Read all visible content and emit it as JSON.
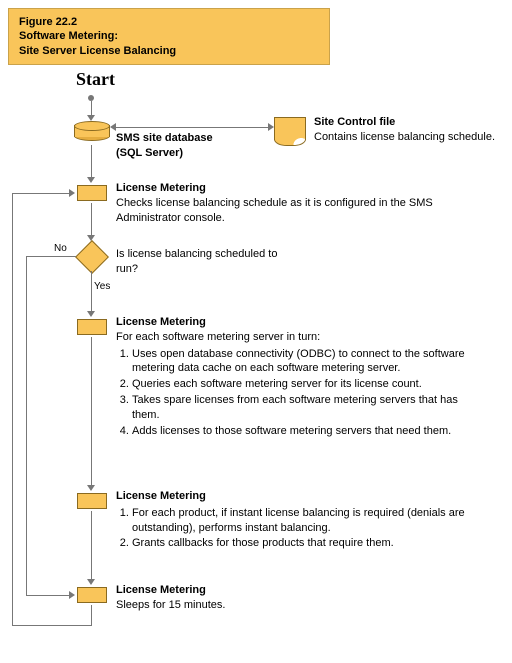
{
  "figure": {
    "number": "Figure 22.2",
    "title1": "Software Metering:",
    "title2": "Site Server License Balancing"
  },
  "start": "Start",
  "db": {
    "label1": "SMS site database",
    "label2": "(SQL Server)"
  },
  "sitectrl": {
    "heading": "Site Control file",
    "text": "Contains license balancing schedule."
  },
  "step1": {
    "heading": "License Metering",
    "text": "Checks license balancing schedule as it is configured in the SMS Administrator console."
  },
  "decision": {
    "question": "Is license balancing scheduled to run?",
    "yes": "Yes",
    "no": "No"
  },
  "step2": {
    "heading": "License Metering",
    "intro": "For each software metering server in turn:",
    "items": [
      "Uses open database connectivity (ODBC) to connect to the software metering data cache on each software metering server.",
      "Queries each software metering server for its license count.",
      "Takes spare licenses from each software metering servers that has them.",
      "Adds licenses to those software metering servers that need them."
    ]
  },
  "step3": {
    "heading": "License Metering",
    "items": [
      "For each product, if instant license balancing is required (denials are outstanding), performs instant balancing.",
      "Grants callbacks for those products that require them."
    ]
  },
  "step4": {
    "heading": "License Metering",
    "text": "Sleeps for 15 minutes."
  },
  "chart_data": {
    "type": "flowchart",
    "title": "Figure 22.2 — Software Metering: Site Server License Balancing",
    "nodes": [
      {
        "id": "start",
        "kind": "start",
        "label": "Start"
      },
      {
        "id": "db",
        "kind": "datastore",
        "label": "SMS site database (SQL Server)"
      },
      {
        "id": "sitectl",
        "kind": "document",
        "label": "Site Control file — Contains license balancing schedule."
      },
      {
        "id": "lm1",
        "kind": "process",
        "label": "License Metering — Checks license balancing schedule as it is configured in the SMS Administrator console."
      },
      {
        "id": "dec",
        "kind": "decision",
        "label": "Is license balancing scheduled to run?"
      },
      {
        "id": "lm2",
        "kind": "process",
        "label": "License Metering — For each software metering server in turn: 1. Uses ODBC to connect to the software metering data cache on each software metering server. 2. Queries each software metering server for its license count. 3. Takes spare licenses from each software metering server that has them. 4. Adds licenses to those software metering servers that need them."
      },
      {
        "id": "lm3",
        "kind": "process",
        "label": "License Metering — 1. For each product, if instant license balancing is required (denials are outstanding), performs instant balancing. 2. Grants callbacks for those products that require them."
      },
      {
        "id": "lm4",
        "kind": "process",
        "label": "License Metering — Sleeps for 15 minutes."
      }
    ],
    "edges": [
      {
        "from": "start",
        "to": "db"
      },
      {
        "from": "db",
        "to": "sitectl",
        "bidirectional": true
      },
      {
        "from": "db",
        "to": "lm1"
      },
      {
        "from": "lm1",
        "to": "dec"
      },
      {
        "from": "dec",
        "to": "lm2",
        "label": "Yes"
      },
      {
        "from": "dec",
        "to": "lm4",
        "label": "No"
      },
      {
        "from": "lm2",
        "to": "lm3"
      },
      {
        "from": "lm3",
        "to": "lm4"
      },
      {
        "from": "lm4",
        "to": "lm1",
        "note": "loop back"
      }
    ]
  }
}
